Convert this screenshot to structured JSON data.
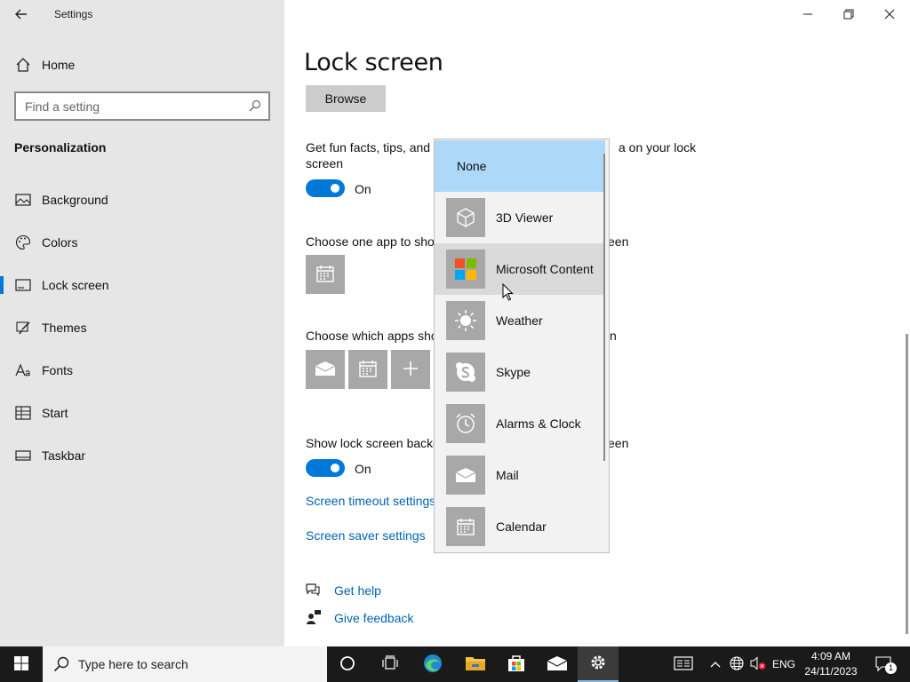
{
  "window": {
    "app_title": "Settings",
    "controls": [
      "minimize",
      "restore",
      "close"
    ]
  },
  "sidebar": {
    "home_label": "Home",
    "search": {
      "placeholder": "Find a setting"
    },
    "section_heading": "Personalization",
    "items": [
      {
        "label": "Background",
        "icon": "image-icon"
      },
      {
        "label": "Colors",
        "icon": "palette-icon"
      },
      {
        "label": "Lock screen",
        "icon": "lock-screen-icon",
        "selected": true
      },
      {
        "label": "Themes",
        "icon": "brush-icon"
      },
      {
        "label": "Fonts",
        "icon": "font-icon"
      },
      {
        "label": "Start",
        "icon": "start-grid-icon"
      },
      {
        "label": "Taskbar",
        "icon": "taskbar-icon"
      }
    ]
  },
  "main": {
    "title": "Lock screen",
    "browse_label": "Browse",
    "fun_facts": {
      "text_left": "Get fun facts, tips, and m",
      "text_right": "a on your lock",
      "text_line2": "screen",
      "toggle_label": "On"
    },
    "one_app": {
      "text_left": "Choose one app to sho",
      "text_right": "een"
    },
    "quick_status": {
      "text_left": "Choose which apps sho",
      "text_right": "n"
    },
    "background": {
      "text_left": "Show lock screen backg",
      "text_right": "een",
      "toggle_label": "On"
    },
    "timeout_link": "Screen timeout settings",
    "saver_link": "Screen saver settings",
    "help_link": "Get help",
    "feedback_link": "Give feedback"
  },
  "flyout": {
    "items": [
      {
        "label": "None"
      },
      {
        "label": "3D Viewer",
        "icon": "cube-icon"
      },
      {
        "label": "Microsoft Content",
        "icon": "microsoft-logo-icon"
      },
      {
        "label": "Weather",
        "icon": "sun-icon"
      },
      {
        "label": "Skype",
        "icon": "skype-icon"
      },
      {
        "label": "Alarms & Clock",
        "icon": "clock-icon"
      },
      {
        "label": "Mail",
        "icon": "mail-icon"
      },
      {
        "label": "Calendar",
        "icon": "calendar-icon"
      }
    ]
  },
  "taskbar": {
    "search_placeholder": "Type here to search",
    "language": "ENG",
    "time": "4:09 AM",
    "date": "24/11/2023",
    "notification_count": "1"
  },
  "colors": {
    "accent": "#0078d7",
    "link": "#0063b1",
    "sidebar_bg": "#e6e6e6",
    "flyout_selected": "#add8f7",
    "taskbar_bg": "#1a1a1a"
  }
}
